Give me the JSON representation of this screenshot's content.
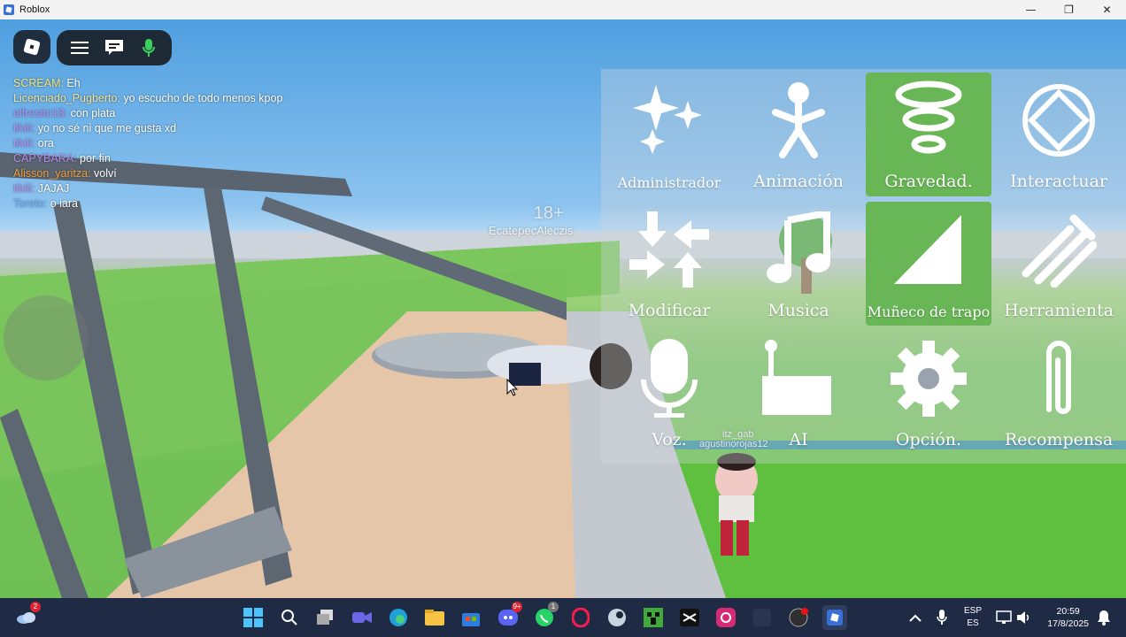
{
  "window": {
    "title": "Roblox",
    "controls": {
      "minimize": "—",
      "maximize": "❐",
      "close": "✕"
    }
  },
  "chat": [
    {
      "name": "SCREAM:",
      "message": " Eh",
      "color": "#f5e67a"
    },
    {
      "name": "Licenciado_Pugberto:",
      "message": " yo escucho de todo menos kpop",
      "color": "#f0e39a"
    },
    {
      "name": "elfresito18:",
      "message": " con plata",
      "color": "#b78cf0"
    },
    {
      "name": "tikiii:",
      "message": " yo no sé ni que me gusta xd",
      "color": "#b78cf0"
    },
    {
      "name": "tikiii:",
      "message": " ora",
      "color": "#b78cf0"
    },
    {
      "name": "CAPYBARA:",
      "message": " por fin",
      "color": "#b78cf0"
    },
    {
      "name": "Alisson_yaritza:",
      "message": " volví",
      "color": "#f0a040"
    },
    {
      "name": "tikiii:",
      "message": " JAJAJ",
      "color": "#b78cf0"
    },
    {
      "name": "Toreto:",
      "message": " o iara",
      "color": "#6fb5ff"
    }
  ],
  "nametags": {
    "age": "18+",
    "player1": "EcatepecAleczis",
    "player2_line1": "itz_gab",
    "player2_line2": "agustinorojas12"
  },
  "menu": [
    {
      "label": "Administrador",
      "icon": "sparkles-icon",
      "active": false
    },
    {
      "label": "Animación",
      "icon": "stick-figure-icon",
      "active": false
    },
    {
      "label": "Gravedad.",
      "icon": "gravity-rings-icon",
      "active": true
    },
    {
      "label": "Interactuar",
      "icon": "diamond-circle-icon",
      "active": false
    },
    {
      "label": "Modificar",
      "icon": "arrows-inward-icon",
      "active": false
    },
    {
      "label": "Musica",
      "icon": "music-note-icon",
      "active": false
    },
    {
      "label": "Muñeco de trapo",
      "icon": "ragdoll-triangle-icon",
      "active": true
    },
    {
      "label": "Herramienta",
      "icon": "tool-stripes-icon",
      "active": false
    },
    {
      "label": "Voz.",
      "icon": "microphone-icon",
      "active": false
    },
    {
      "label": "AI",
      "icon": "robot-icon",
      "active": false
    },
    {
      "label": "Opción.",
      "icon": "gear-icon",
      "active": false
    },
    {
      "label": "Recompensa",
      "icon": "paperclip-icon",
      "active": false
    }
  ],
  "taskbar": {
    "weather_badge": "2",
    "discord_badge": "9+",
    "whatsapp_badge": "1",
    "lang_line1": "ESP",
    "lang_line2": "ES",
    "time": "20:59",
    "date": "17/8/2025"
  },
  "colors": {
    "active_tile": "#68b656",
    "taskbar": "#1f2a44"
  }
}
